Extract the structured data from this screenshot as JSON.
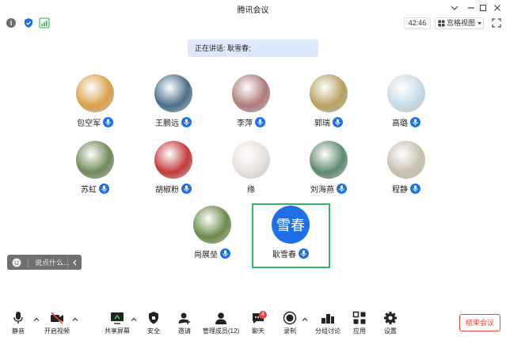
{
  "window": {
    "title": "腾讯会议"
  },
  "toolbar": {
    "time": "42:46",
    "view_label": "宫格视图"
  },
  "speaking": {
    "text": "正在讲话: 耿雪春;"
  },
  "participants": [
    {
      "name": "包空军",
      "avatar_color": "#d9a14a"
    },
    {
      "name": "王鹏远",
      "avatar_color": "#4a6e8a"
    },
    {
      "name": "李萍",
      "avatar_color": "#b07a7a"
    },
    {
      "name": "郭瑞",
      "avatar_color": "#b8a060"
    },
    {
      "name": "高璐",
      "avatar_color": "#c8dbe8"
    },
    {
      "name": "苏虹",
      "avatar_color": "#6f8a5a"
    },
    {
      "name": "胡椒粉",
      "avatar_color": "#c43a3a"
    },
    {
      "name": "缘",
      "avatar_color": "#e8e0dc"
    },
    {
      "name": "刘海燕",
      "avatar_color": "#5f8a6f"
    },
    {
      "name": "程静",
      "avatar_color": "#c9bfae"
    },
    {
      "name": "尚展垒",
      "avatar_color": "#6a8a4a"
    },
    {
      "name": "耿雪春",
      "avatar_text": "雪春",
      "avatar_color": "#1f6fe5"
    }
  ],
  "chat": {
    "placeholder": "说点什么..."
  },
  "bottom": {
    "mute": "静音",
    "video": "开启视频",
    "share": "共享屏幕",
    "security": "安全",
    "invite": "邀请",
    "members": "管理成员(12)",
    "chat": "聊天",
    "chat_badge": "4",
    "record": "录制",
    "breakout": "分组讨论",
    "apps": "应用",
    "settings": "设置",
    "end": "结束会议"
  },
  "colors": {
    "accent": "#1f6fe5",
    "active_border": "#33b868",
    "danger": "#e8453c",
    "banner": "#dce9fb"
  }
}
